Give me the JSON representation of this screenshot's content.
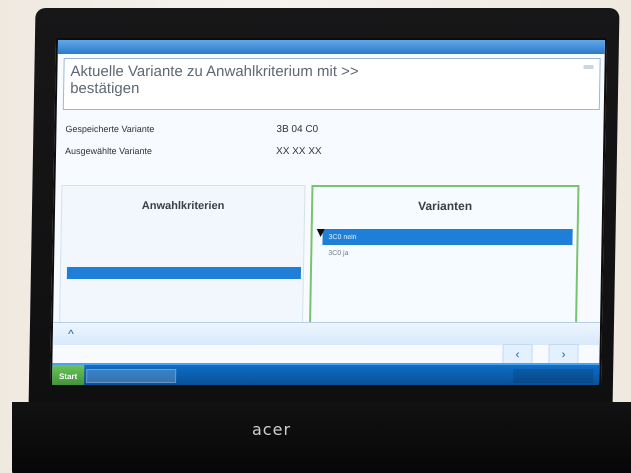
{
  "dialog": {
    "window_title": "",
    "prompt": "Aktuelle Variante zu Anwahlkriterium mit >> bestätigen"
  },
  "details": {
    "saved_label": "Gespeicherte Variante",
    "saved_value": "3B 04 C0",
    "selected_label": "Ausgewählte Variante",
    "selected_value": "XX XX XX"
  },
  "left_panel": {
    "title": "Anwahlkriterien",
    "items": [
      "",
      "",
      ""
    ]
  },
  "right_panel": {
    "title": "Varianten",
    "items": [
      {
        "label": "3C0 nein",
        "selected": true
      },
      {
        "label": "3C0 ja",
        "selected": false
      }
    ]
  },
  "nav": {
    "home_icon": "home-arrow-icon",
    "prev_icon": "chevron-left-icon",
    "next_icon": "chevron-right-icon",
    "prev_symbol": "‹",
    "next_symbol": "›",
    "home_symbol": "^"
  },
  "taskbar": {
    "start": "Start",
    "task": "",
    "tray": ""
  },
  "laptop": {
    "brand": "acer"
  }
}
